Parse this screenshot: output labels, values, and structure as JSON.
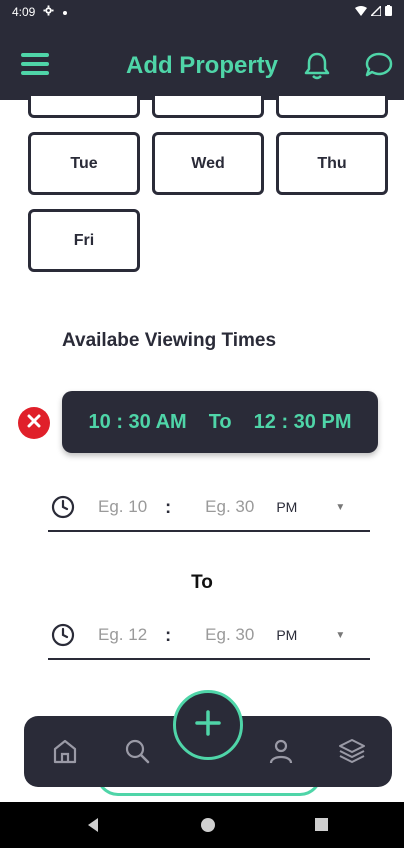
{
  "status_bar": {
    "time": "4:09",
    "icons": [
      "gear-icon",
      "dot-icon",
      "wifi-icon",
      "signal-icon",
      "battery-icon"
    ]
  },
  "app_bar": {
    "title": "Add Property",
    "icons": [
      "menu-icon",
      "bell-icon",
      "chat-icon"
    ],
    "accent": "#4fd5a8",
    "background": "#2a2b38"
  },
  "days": {
    "tue": "Tue",
    "wed": "Wed",
    "thu": "Thu",
    "fri": "Fri"
  },
  "viewing": {
    "title": "Availabe Viewing Times",
    "chip": {
      "start": "10 : 30 AM",
      "separator": "To",
      "end": "12 : 30 PM"
    }
  },
  "from_time": {
    "hour_placeholder": "Eg. 10",
    "colon": ":",
    "minute_placeholder": "Eg. 30",
    "period": "PM"
  },
  "to_label": "To",
  "to_time": {
    "hour_placeholder": "Eg. 12",
    "colon": ":",
    "minute_placeholder": "Eg. 30",
    "period": "PM"
  },
  "bottom_nav": {
    "items": [
      "home-icon",
      "search-icon",
      "add-icon",
      "profile-icon",
      "layers-icon"
    ]
  },
  "colors": {
    "remove": "#e0202a",
    "dark": "#2a2b38"
  }
}
